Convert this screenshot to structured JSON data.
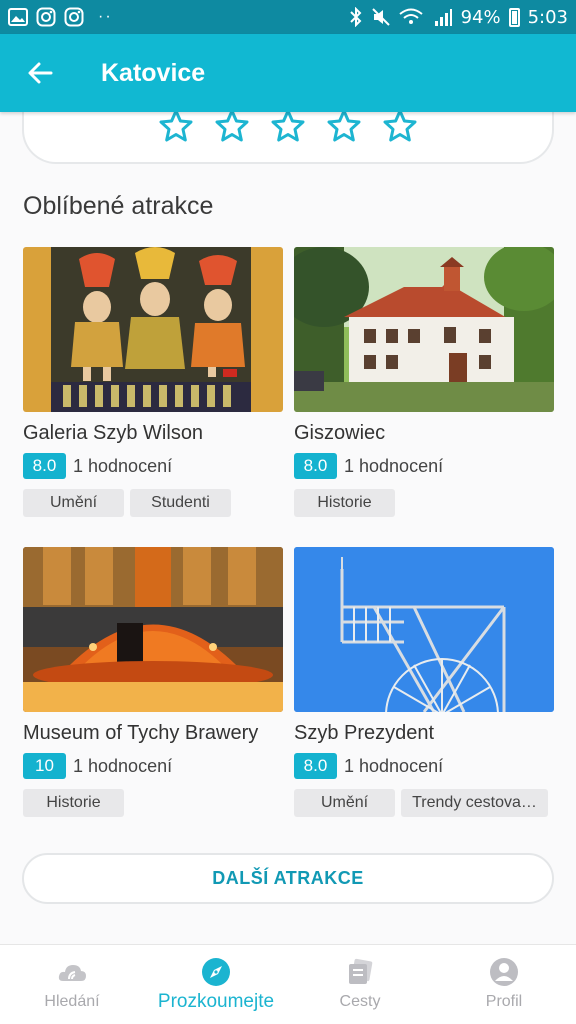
{
  "status_bar": {
    "battery": "94%",
    "time": "5:03",
    "dots": "··",
    "icons": [
      "gallery-icon",
      "instagram-icon",
      "instagram-icon",
      "bluetooth-icon",
      "mute-icon",
      "wifi-icon",
      "signal-icon",
      "battery-icon"
    ]
  },
  "header": {
    "title": "Katovice",
    "back_icon": "arrow-left-icon"
  },
  "rating": {
    "stars_total": 5,
    "stars_filled": 0
  },
  "section": {
    "title": "Oblíbené atrakce"
  },
  "attractions": [
    {
      "name": "Galeria Szyb Wilson",
      "score": "8.0",
      "reviews": "1 hodnocení",
      "tags": [
        "Umění",
        "Studenti"
      ]
    },
    {
      "name": "Giszowiec",
      "score": "8.0",
      "reviews": "1 hodnocení",
      "tags": [
        "Historie"
      ]
    },
    {
      "name": "Museum of Tychy Brawery",
      "score": "10",
      "reviews": "1 hodnocení",
      "tags": [
        "Historie"
      ]
    },
    {
      "name": "Szyb Prezydent",
      "score": "8.0",
      "reviews": "1 hodnocení",
      "tags": [
        "Umění",
        "Trendy cestova…"
      ]
    }
  ],
  "more_button": "DALŠÍ ATRAKCE",
  "bottom_nav": {
    "items": [
      {
        "label": "Hledání",
        "icon": "cloud-search-icon",
        "active": false
      },
      {
        "label": "Prozkoumejte",
        "icon": "compass-icon",
        "active": true
      },
      {
        "label": "Cesty",
        "icon": "cards-icon",
        "active": false
      },
      {
        "label": "Profil",
        "icon": "user-icon",
        "active": false
      }
    ]
  },
  "colors": {
    "primary": "#11b8d2",
    "status_bar": "#0e8aa1",
    "accent_text": "#1199b4",
    "score_bg": "#14b2cf",
    "tag_bg": "#e8e8ea"
  }
}
